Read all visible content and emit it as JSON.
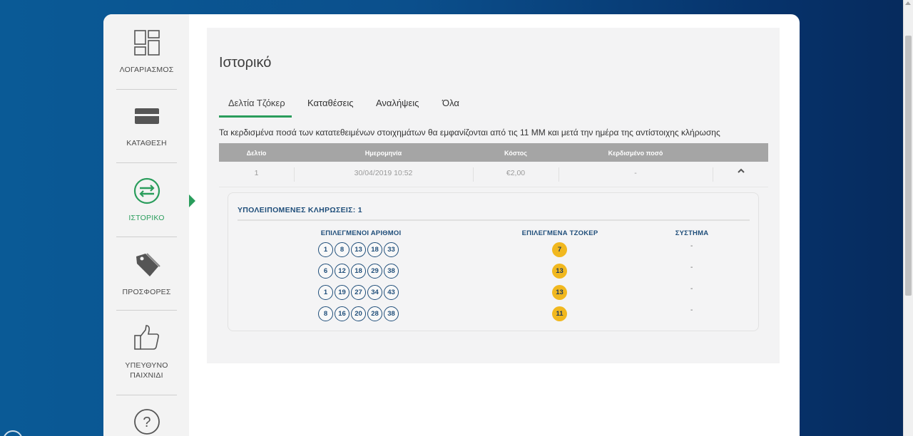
{
  "sidebar": {
    "items": [
      {
        "label": "ΛΟΓΑΡΙΑΣΜΟΣ",
        "icon": "dashboard-icon"
      },
      {
        "label": "ΚΑΤΑΘΕΣΗ",
        "icon": "card-icon"
      },
      {
        "label": "ΙΣΤΟΡΙΚΟ",
        "icon": "transfer-arrows-icon",
        "active": true
      },
      {
        "label": "ΠΡΟΣΦΟΡΕΣ",
        "icon": "tag-icon"
      },
      {
        "label_line1": "ΥΠΕΥΘΥΝΟ",
        "label_line2": "ΠΑΙΧΝΙΔΙ",
        "icon": "thumbs-up-icon"
      },
      {
        "icon": "help-icon"
      }
    ],
    "active_color": "#2a9d5c"
  },
  "main": {
    "title": "Ιστορικό",
    "tabs": [
      {
        "label": "Δελτία Τζόκερ",
        "active": true
      },
      {
        "label": "Καταθέσεις"
      },
      {
        "label": "Αναλήψεις"
      },
      {
        "label": "Όλα"
      }
    ],
    "info": "Τα κερδισμένα ποσά των κατατεθειμένων στοιχημάτων θα εμφανίζονται από τις 11 ΜΜ και μετά την ημέρα της αντίστοιχης κλήρωσης",
    "table": {
      "headers": [
        "Δελτίο",
        "Ημερομηνία",
        "Κόστος",
        "Κερδισμένο ποσό"
      ],
      "row": {
        "id": "1",
        "date": "30/04/2019 10:52",
        "cost": "€2,00",
        "win": "-"
      }
    },
    "details": {
      "remaining": "ΥΠΟΛΕΙΠΟΜΕΝΕΣ ΚΛΗΡΩΣΕΙΣ: 1",
      "col_numbers": "ΕΠΙΛΕΓΜΕΝΟΙ ΑΡΙΘΜΟΙ",
      "col_joker": "ΕΠΙΛΕΓΜΕΝΑ ΤΖΟΚΕΡ",
      "col_system": "ΣΥΣΤΗΜΑ",
      "rows": [
        {
          "numbers": [
            "1",
            "8",
            "13",
            "18",
            "33"
          ],
          "joker": "7",
          "system": "-"
        },
        {
          "numbers": [
            "6",
            "12",
            "18",
            "29",
            "38"
          ],
          "joker": "13",
          "system": "-"
        },
        {
          "numbers": [
            "1",
            "19",
            "27",
            "34",
            "43"
          ],
          "joker": "13",
          "system": "-"
        },
        {
          "numbers": [
            "8",
            "16",
            "20",
            "28",
            "38"
          ],
          "joker": "11",
          "system": "-"
        }
      ]
    }
  },
  "colors": {
    "accent": "#2a9d5c",
    "joker": "#f1b81f",
    "numbers": "#1f4e7a"
  }
}
